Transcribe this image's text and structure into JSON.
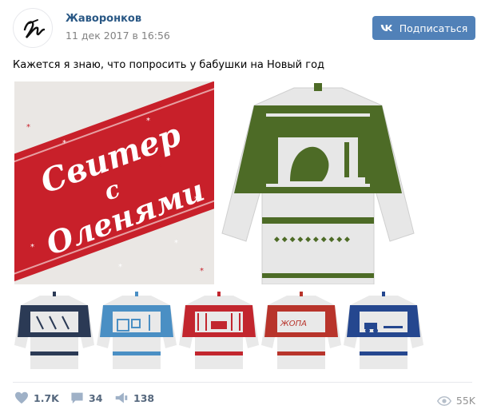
{
  "post": {
    "author": "Жаворонков",
    "date": "11 дек 2017 в 16:56",
    "subscribe_label": "Подписаться",
    "text": "Кажется я знаю, что попросить у бабушки на Новый год"
  },
  "images": {
    "banner_line1": "Свитер",
    "banner_line2": "с",
    "banner_line3": "Оленями",
    "thumb4_caption": "ЖОПА"
  },
  "colors": {
    "vk_blue": "#5181b8",
    "link_blue": "#2a5885",
    "banner_red": "#c8202a",
    "sweater_green": "#4d6b26",
    "sweater_navy": "#2b3a55",
    "sweater_sky": "#4a8fc4",
    "sweater_red": "#c2262e",
    "sweater_darkred": "#b8342b",
    "sweater_blue": "#25478f"
  },
  "stats": {
    "likes": "1.7K",
    "comments": "34",
    "shares": "138",
    "views": "55K"
  },
  "icons": [
    "heart-icon",
    "comment-icon",
    "share-icon",
    "eye-icon",
    "vk-logo-icon"
  ]
}
